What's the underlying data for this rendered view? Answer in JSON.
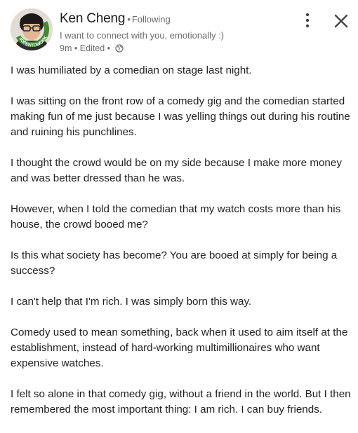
{
  "author": {
    "name": "Ken Cheng",
    "separator": "•",
    "follow_status": "Following",
    "headline": "I want to connect with you, emotionally :)",
    "time": "9m",
    "edited": "Edited",
    "visibility_icon": "globe-icon",
    "avatar_badge": "#OPENTOWORK"
  },
  "icons": {
    "menu": "more-vertical-icon",
    "close": "close-icon"
  },
  "colors": {
    "text": "#1f1f1f",
    "muted": "#6b6b6b",
    "open_to_work_ring": "#3f8a2e"
  },
  "post": {
    "paragraphs": [
      "I was humiliated by a comedian on stage last night.",
      "I was sitting on the front row of a comedy gig and the comedian started making fun of me just because I was yelling things out during his routine and ruining his punchlines.",
      "I thought the crowd would be on my side because I make more money and was better dressed than he was.",
      "However, when I told the comedian that my watch costs more than his house, the crowd booed me?",
      "Is this what society has become? You are booed at simply for being a success?",
      "I can't help that I'm rich. I was simply born this way.",
      "Comedy used to mean something, back when it used to aim itself at the establishment, instead of hard-working multimillionaires who want expensive watches.",
      "I felt so alone in that comedy gig, without a friend in the world. But I then remembered the most important thing: I am rich. I can buy friends."
    ]
  }
}
